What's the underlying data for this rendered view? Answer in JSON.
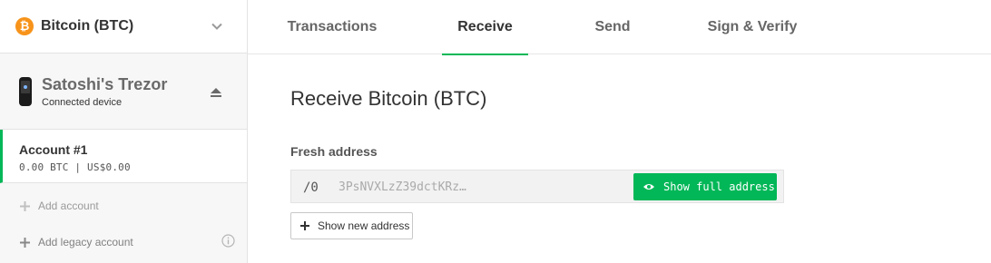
{
  "coin": {
    "label": "Bitcoin (BTC)",
    "icon": "bitcoin-icon",
    "color": "#f7931a"
  },
  "device": {
    "name": "Satoshi's Trezor",
    "status": "Connected device"
  },
  "account": {
    "name": "Account #1",
    "balance": "0.00 BTC | US$0.00"
  },
  "sidebar_actions": {
    "add_account": "Add account",
    "add_legacy": "Add legacy account"
  },
  "tabs": [
    {
      "label": "Transactions"
    },
    {
      "label": "Receive",
      "active": true
    },
    {
      "label": "Send"
    },
    {
      "label": "Sign & Verify"
    }
  ],
  "receive": {
    "title": "Receive Bitcoin (BTC)",
    "fresh_label": "Fresh address",
    "path": "/0",
    "address": "3PsNVXLzZ39dctKRz…",
    "show_full_label": "Show full address",
    "show_new_label": "Show new address"
  },
  "colors": {
    "accent": "#01b757",
    "muted": "#9a9a9a"
  }
}
